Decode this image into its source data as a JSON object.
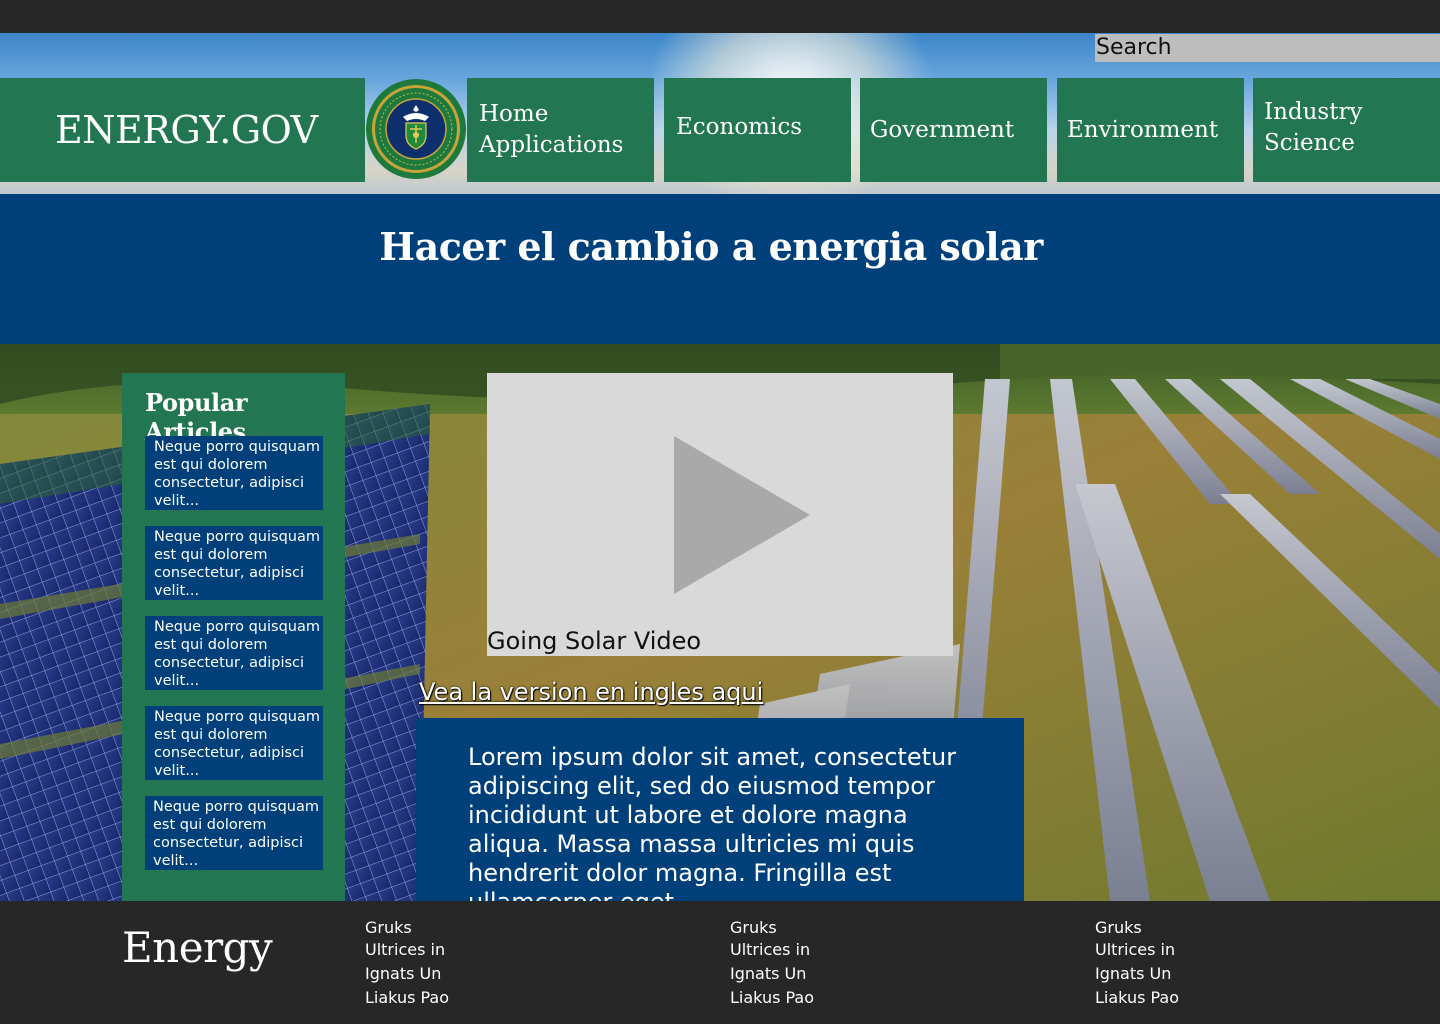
{
  "search": {
    "placeholder": "Search"
  },
  "brand": {
    "title": "ENERGY.GOV"
  },
  "seal": {
    "label": "DEPARTMENT OF ENERGY · UNITED STATES OF AMERICA"
  },
  "nav": {
    "items": [
      {
        "lines": [
          "Home",
          "Applications"
        ]
      },
      {
        "lines": [
          "Economics"
        ]
      },
      {
        "lines": [
          "Government"
        ]
      },
      {
        "lines": [
          "Environment"
        ]
      },
      {
        "lines": [
          "Industry",
          "Science"
        ]
      }
    ]
  },
  "page": {
    "title": "Hacer el cambio a energia solar"
  },
  "popular": {
    "title": "Popular Articles",
    "articles": [
      "Neque porro quisquam est qui dolorem consectetur, adipisci velit...",
      "Neque porro quisquam est qui dolorem consectetur, adipisci velit...",
      "Neque porro quisquam est qui dolorem consectetur, adipisci velit...",
      "Neque porro quisquam est qui dolorem consectetur, adipisci velit...",
      "Neque porro quisquam est qui dolorem consectetur, adipisci velit..."
    ]
  },
  "video": {
    "caption": "Going Solar Video",
    "icon": "play-icon"
  },
  "links": {
    "english": "Vea la version en ingles aqui"
  },
  "content": {
    "body": "Lorem ipsum dolor sit amet, consectetur adipiscing elit, sed do eiusmod tempor incididunt ut labore et dolore magna aliqua. Massa massa ultricies mi quis hendrerit dolor magna. Fringilla est ullamcorper eget."
  },
  "footer": {
    "brand": "Energy",
    "columns": [
      [
        "Gruks",
        "Ultrices in",
        "Ignats Un",
        "Liakus Pao"
      ],
      [
        "Gruks",
        "Ultrices in",
        "Ignats Un",
        "Liakus Pao"
      ],
      [
        "Gruks",
        "Ultrices in",
        "Ignats Un",
        "Liakus Pao"
      ]
    ]
  },
  "colors": {
    "green": "#227651",
    "navy": "#00407a",
    "dark": "#272727",
    "video_bg": "#d9d9d9"
  }
}
